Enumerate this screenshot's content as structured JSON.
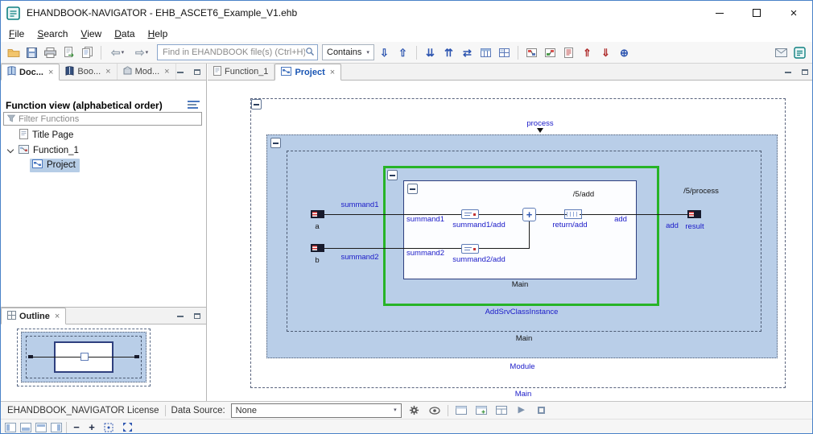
{
  "window": {
    "title": "EHANDBOOK-NAVIGATOR - EHB_ASCET6_Example_V1.ehb"
  },
  "menu": {
    "items": [
      {
        "label": "File"
      },
      {
        "label": "Search"
      },
      {
        "label": "View"
      },
      {
        "label": "Data"
      },
      {
        "label": "Help"
      }
    ]
  },
  "toolbar": {
    "search_placeholder": "Find in EHANDBOOK file(s) (Ctrl+H)",
    "contains_label": "Contains"
  },
  "left_panel": {
    "tabs": [
      {
        "label": "Doc..."
      },
      {
        "label": "Boo..."
      },
      {
        "label": "Mod..."
      }
    ],
    "function_view_title": "Function view (alphabetical order)",
    "filter_placeholder": "Filter Functions",
    "tree": {
      "items": [
        {
          "label": "Title Page"
        },
        {
          "label": "Function_1"
        },
        {
          "label": "Project"
        }
      ]
    }
  },
  "outline_panel": {
    "tab_label": "Outline"
  },
  "editor": {
    "tabs": [
      {
        "label": "Function_1"
      },
      {
        "label": "Project"
      }
    ]
  },
  "diagram": {
    "process_label": "process",
    "outer_main_label": "Main",
    "module_label": "Module",
    "mid_main_label": "Main",
    "instance_label": "AddSrvClassInstance",
    "inner_main_label": "Main",
    "input_a_label": "a",
    "input_b_label": "b",
    "summand1_wire_label": "summand1",
    "summand2_wire_label": "summand2",
    "summand1_pin_label": "summand1",
    "summand2_pin_label": "summand2",
    "summand1_add_label": "summand1/add",
    "summand2_add_label": "summand2/add",
    "return_add_label": "return/add",
    "add_path_label": "/5/add",
    "add_inner_label": "add",
    "add_outer_label": "add",
    "process_path_label": "/5/process",
    "result_label": "result"
  },
  "status_bar": {
    "license_text": "EHANDBOOK_NAVIGATOR License",
    "data_source_label": "Data Source:",
    "data_source_value": "None"
  },
  "icons": {
    "close": "×",
    "caret_down": "▾",
    "back_arrow": "⇦",
    "forward_arrow": "⇨",
    "find_next": "⇩",
    "find_prev": "⇧",
    "expand_all": "⇊",
    "collapse_all": "⇈",
    "sync": "⇄",
    "nav_up": "⇑",
    "nav_down": "⇓",
    "link": "⊕",
    "play": "▶",
    "minus": "−",
    "plus": "+"
  },
  "colors": {
    "accent_blue": "#1a1ac8",
    "module_fill": "#b9cee8",
    "instance_border": "#27b427",
    "tree_selection": "#b6cde6"
  }
}
